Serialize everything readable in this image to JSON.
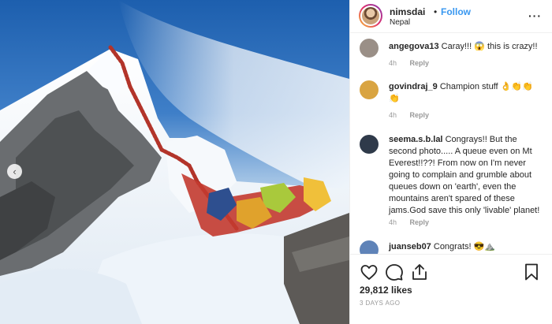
{
  "post": {
    "username": "nimsdai",
    "separator": "•",
    "follow_label": "Follow",
    "location": "Nepal",
    "more_label": "···",
    "likes": "29,812 likes",
    "time_ago": "3 DAYS AGO",
    "carousel_prev": "‹"
  },
  "comments": [
    {
      "user": "angegova13",
      "text": "Caray!!! 😱 this is crazy!!",
      "time": "4h",
      "reply": "Reply",
      "avatar_color": "#9a8f87"
    },
    {
      "user": "govindraj_9",
      "text": "Champion stuff 👌👏👏👏",
      "time": "4h",
      "reply": "Reply",
      "avatar_color": "#d9a441"
    },
    {
      "user": "seema.s.b.lal",
      "text": "Congrays!! But the second photo..... A queue even on Mt Everest!!??! From now on I'm never going to complain and grumble about queues down on 'earth', even the mountains aren't spared of these jams.God save this only 'livable' planet!",
      "time": "4h",
      "reply": "Reply",
      "avatar_color": "#2f3a4a"
    },
    {
      "user": "juanseb07",
      "text": "Congrats! 😎⛰️",
      "time": "",
      "reply": "",
      "avatar_color": "#5f83b8"
    }
  ]
}
